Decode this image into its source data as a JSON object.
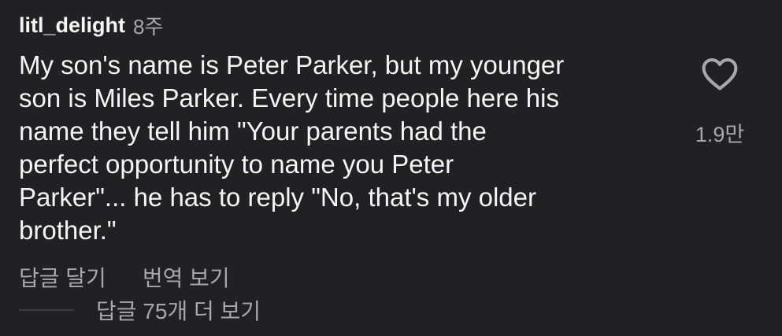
{
  "comment": {
    "username": "litl_delight",
    "time": "8주",
    "text": "My son's name is Peter Parker, but my younger\nson is Miles Parker. Every time people here his\nname they tell him \"Your parents had the\nperfect opportunity to name you Peter\nParker\"... he has to reply \"No, that's my older\nbrother.\"",
    "likes": "1.9만",
    "reply_label": "답글 달기",
    "translate_label": "번역 보기",
    "more_replies_label": "답글 75개 더 보기"
  },
  "icons": {
    "like": "heart-outline-icon"
  },
  "colors": {
    "background": "#212124",
    "primary_text": "#f5f5f5",
    "secondary_text": "#a8a8a8"
  }
}
